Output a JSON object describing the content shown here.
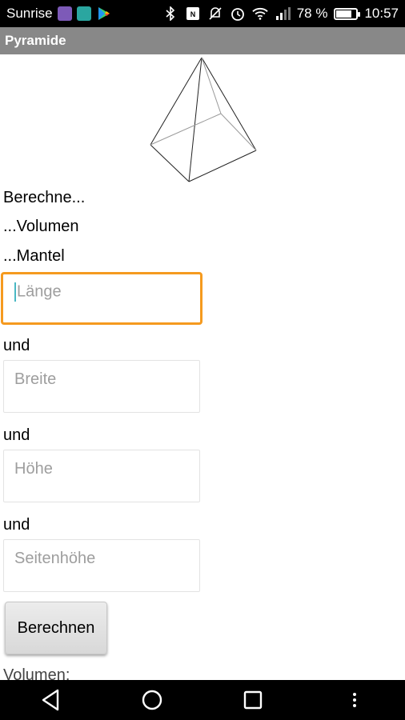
{
  "status_bar": {
    "carrier": "Sunrise",
    "battery": "78 %",
    "battery_level": 0.78,
    "time": "10:57",
    "notification_icons": [
      "viber-icon",
      "tv-icon",
      "play-store-icon"
    ],
    "system_icons": [
      "bluetooth-icon",
      "nfc-icon",
      "mute-icon",
      "alarm-icon",
      "wifi-icon",
      "signal-icon"
    ]
  },
  "app": {
    "title": "Pyramide"
  },
  "main": {
    "intro": "Berechne...",
    "option_volume": "...Volumen",
    "option_mantel": "...Mantel",
    "fields": [
      {
        "placeholder": "Länge",
        "focused": true
      },
      {
        "placeholder": "Breite",
        "focused": false
      },
      {
        "placeholder": "Höhe",
        "focused": false
      },
      {
        "placeholder": "Seitenhöhe",
        "focused": false
      }
    ],
    "connector": "und",
    "button_label": "Berechnen",
    "result_label": "Volumen:"
  },
  "colors": {
    "focus_border": "#f59a1f",
    "title_bar": "#888888",
    "cursor": "#4ab8c4"
  },
  "nav_bar": {
    "buttons": [
      "back-icon",
      "home-icon",
      "recents-icon",
      "menu-icon"
    ]
  }
}
